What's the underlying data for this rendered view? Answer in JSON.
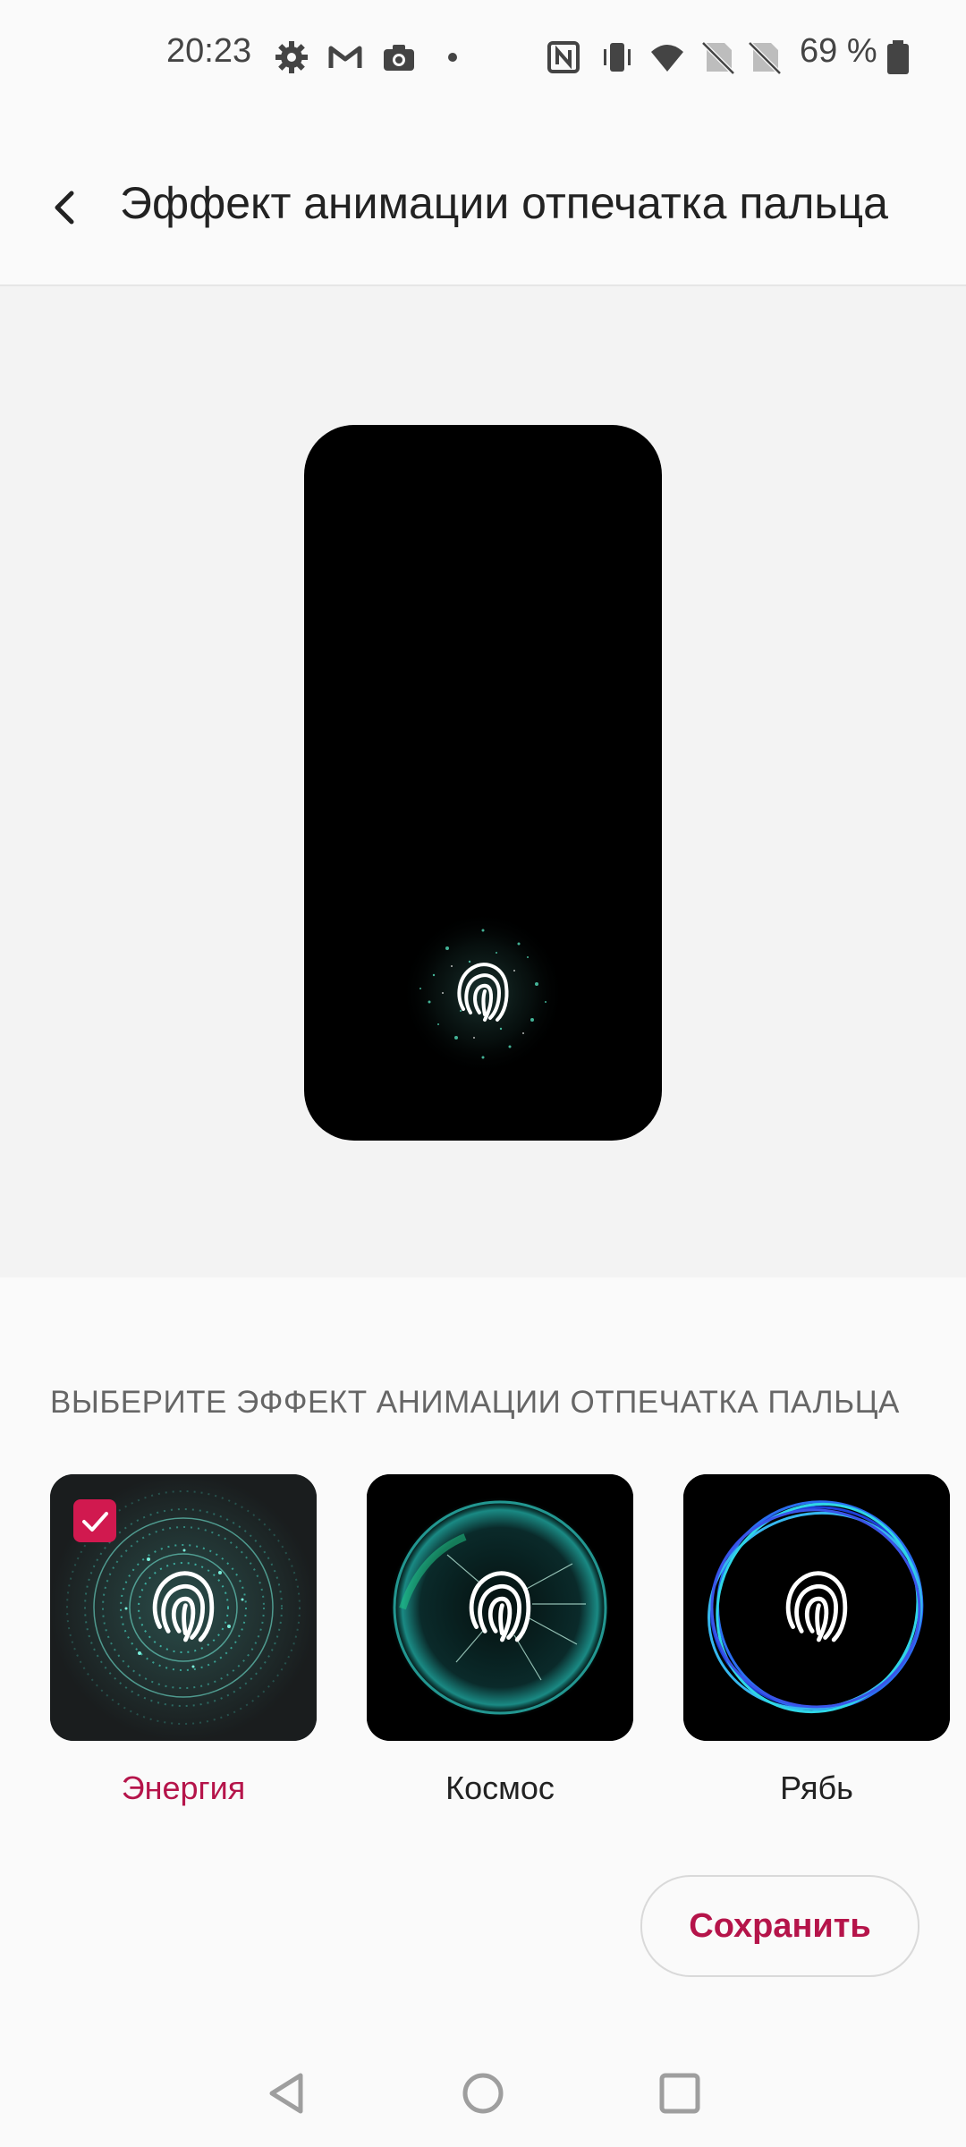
{
  "status_bar": {
    "time": "20:23",
    "battery": "69 %",
    "icons": [
      "gear-icon",
      "gmail-icon",
      "camera-icon",
      "dot-icon",
      "nfc-icon",
      "vibrate-icon",
      "wifi-icon",
      "sim-off-icon",
      "sim-off-icon",
      "battery-icon"
    ]
  },
  "header": {
    "back_icon": "arrow-back-icon",
    "title": "Эффект анимации отпечатка пальца"
  },
  "preview": {
    "icon": "fingerprint-icon"
  },
  "section": {
    "label": "ВЫБЕРИТЕ ЭФФЕКТ АНИМАЦИИ ОТПЕЧАТКА ПАЛЬЦА"
  },
  "options": [
    {
      "label": "Энергия",
      "selected": true
    },
    {
      "label": "Космос",
      "selected": false
    },
    {
      "label": "Рябь",
      "selected": false
    }
  ],
  "actions": {
    "save_label": "Сохранить"
  },
  "navigation": {
    "icons": [
      "nav-back-icon",
      "nav-home-icon",
      "nav-recents-icon"
    ]
  },
  "colors": {
    "accent": "#b5144a",
    "checkbox": "#d1194f",
    "background": "#fafafa",
    "preview_background": "#f3f3f3"
  }
}
